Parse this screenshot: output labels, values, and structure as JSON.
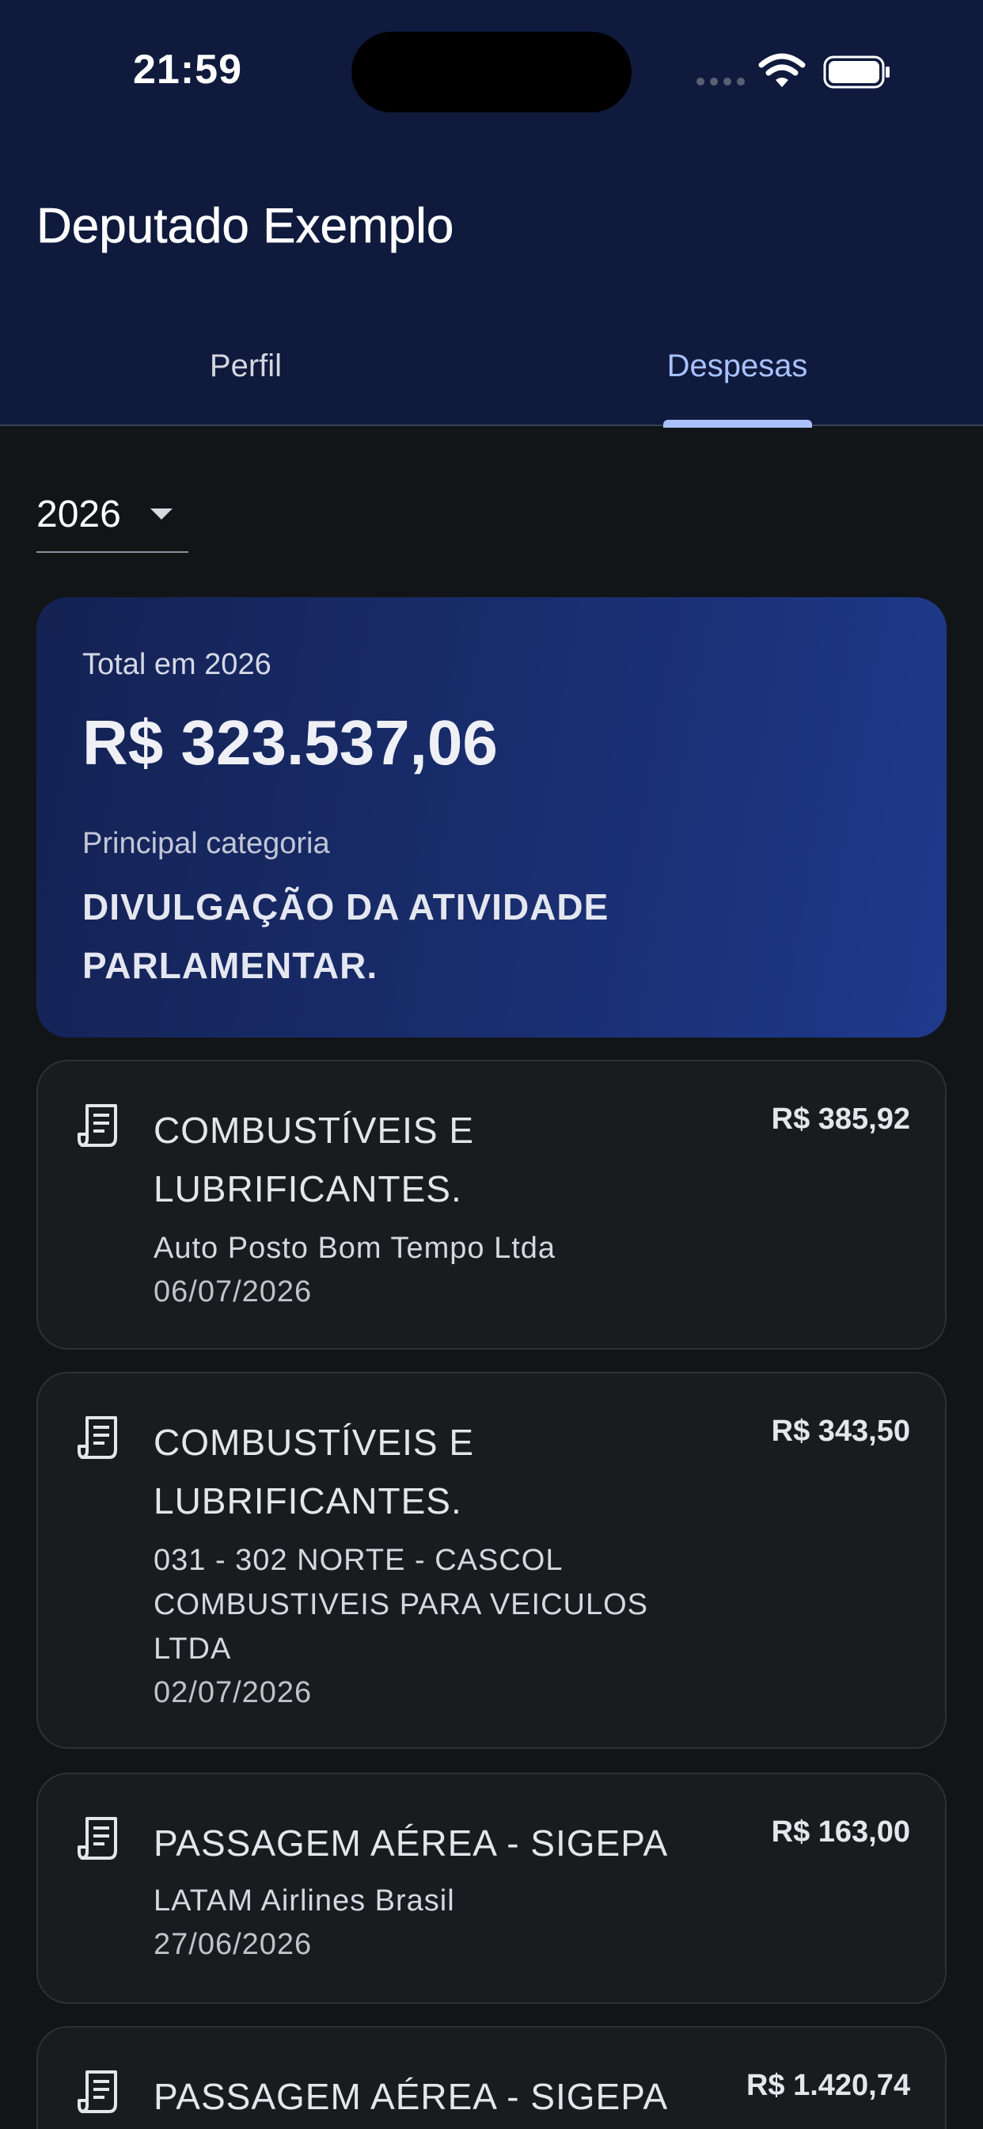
{
  "status_bar": {
    "time": "21:59"
  },
  "header": {
    "title": "Deputado Exemplo",
    "background": "#0f1a3d",
    "tabs": [
      {
        "label": "Perfil",
        "selected": false
      },
      {
        "label": "Despesas",
        "selected": true
      }
    ],
    "accent": "#a9c1ff"
  },
  "filter": {
    "year": "2026"
  },
  "summary": {
    "total_label": "Total em 2026",
    "total_value": "R$ 323.537,06",
    "category_label": "Principal categoria",
    "category_value": "DIVULGAÇÃO DA ATIVIDADE PARLAMENTAR."
  },
  "expenses": [
    {
      "icon": "receipt-icon",
      "category": "COMBUSTÍVEIS E LUBRIFICANTES.",
      "amount": "R$ 385,92",
      "supplier": "Auto Posto Bom Tempo Ltda",
      "date": "06/07/2026"
    },
    {
      "icon": "receipt-icon",
      "category": "COMBUSTÍVEIS E LUBRIFICANTES.",
      "amount": "R$ 343,50",
      "supplier": "031 - 302 NORTE - CASCOL COMBUSTIVEIS PARA VEICULOS LTDA",
      "date": "02/07/2026"
    },
    {
      "icon": "receipt-icon",
      "category": "PASSAGEM AÉREA - SIGEPA",
      "amount": "R$ 163,00",
      "supplier": "LATAM Airlines Brasil",
      "date": "27/06/2026"
    },
    {
      "icon": "receipt-icon",
      "category": "PASSAGEM AÉREA - SIGEPA",
      "amount": "R$ 1.420,74",
      "supplier": "",
      "date": ""
    }
  ]
}
